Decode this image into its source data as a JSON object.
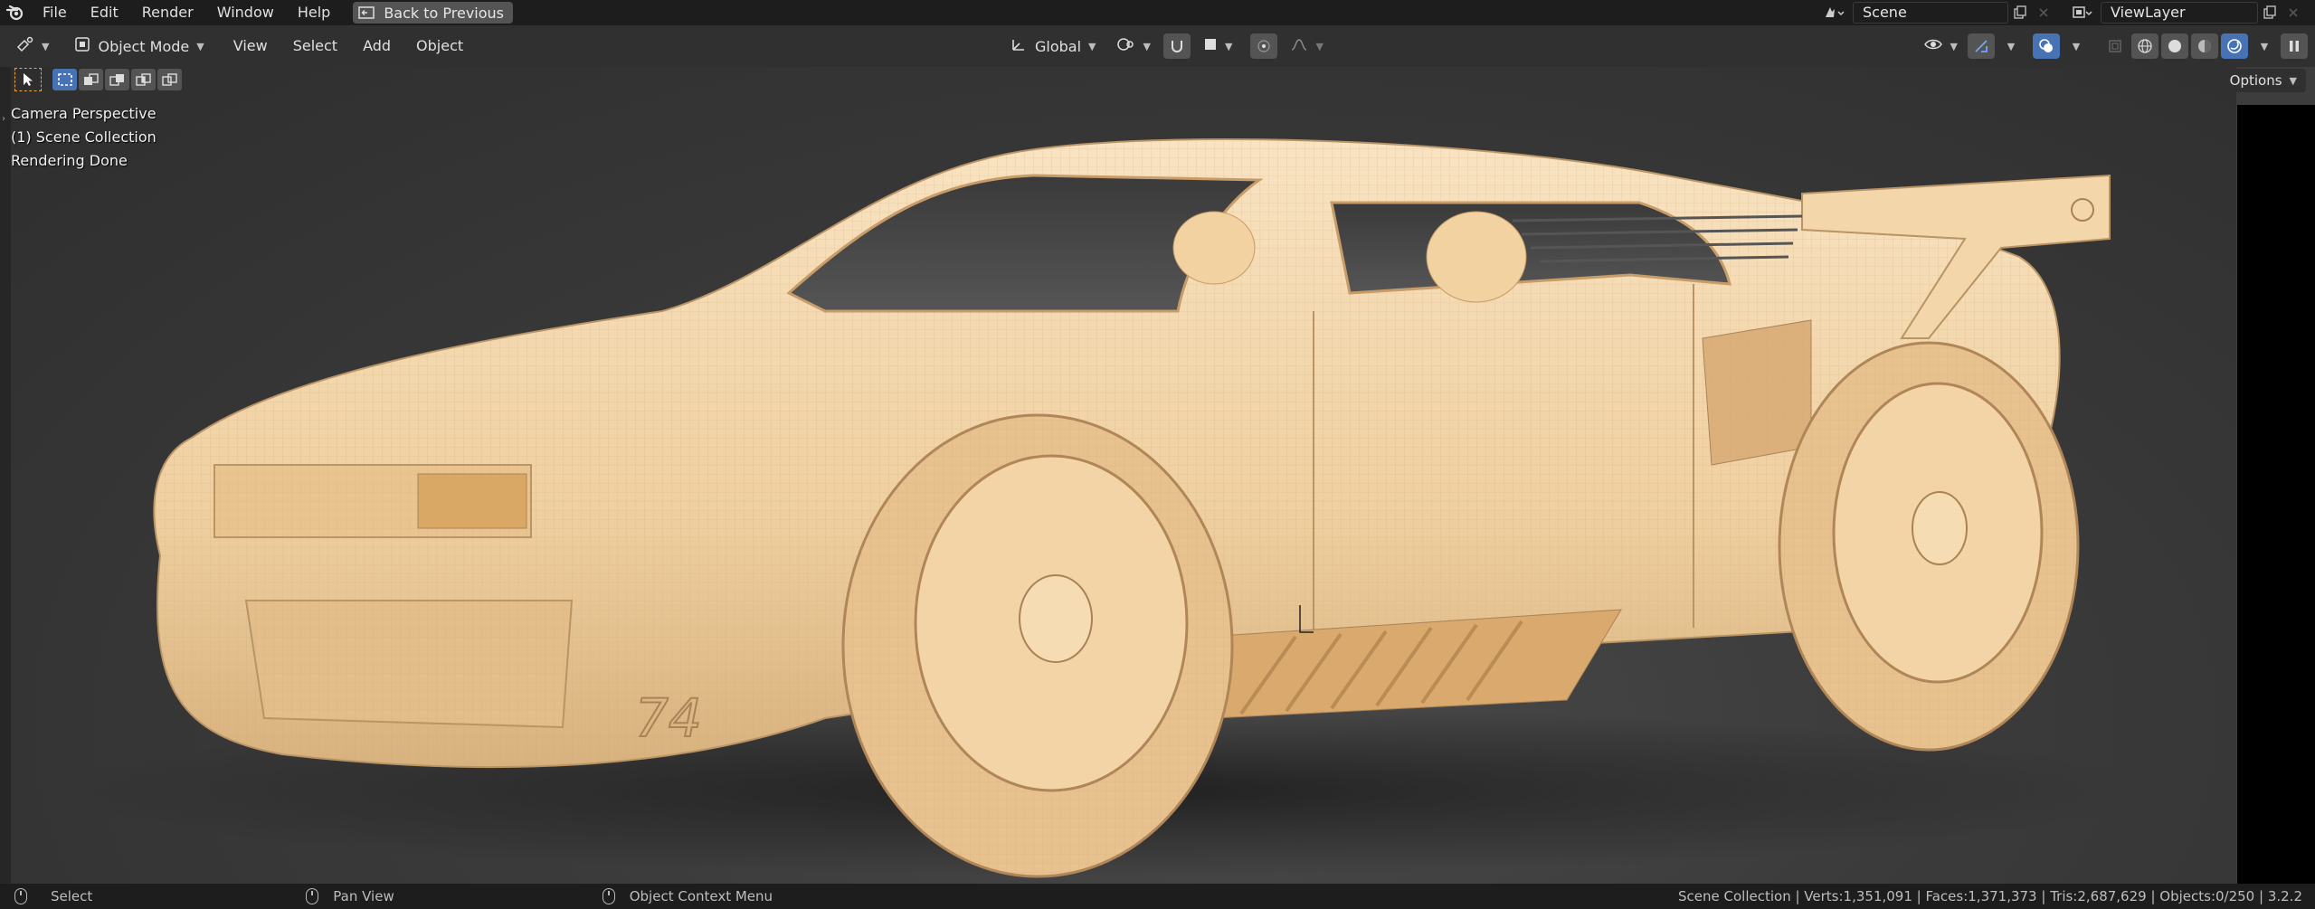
{
  "topbar": {
    "menus": [
      "File",
      "Edit",
      "Render",
      "Window",
      "Help"
    ],
    "back_button": "Back to Previous",
    "scene": "Scene",
    "view_layer": "ViewLayer"
  },
  "header": {
    "mode": "Object Mode",
    "menus": [
      "View",
      "Select",
      "Add",
      "Object"
    ],
    "orientation": "Global"
  },
  "viewport": {
    "info_lines": [
      "Camera Perspective",
      "(1) Scene Collection",
      "Rendering Done"
    ],
    "options": "Options",
    "car_number": "74"
  },
  "statusbar": {
    "select": "Select",
    "pan": "Pan View",
    "context": "Object Context Menu",
    "stats": "Scene Collection | Verts:1,351,091 | Faces:1,371,373 | Tris:2,687,629 | Objects:0/250 | 3.2.2"
  },
  "colors": {
    "accent": "#4772b3",
    "model": "#f3d6a9",
    "background": "#3d3d3d",
    "selection": "#e6a24b"
  }
}
